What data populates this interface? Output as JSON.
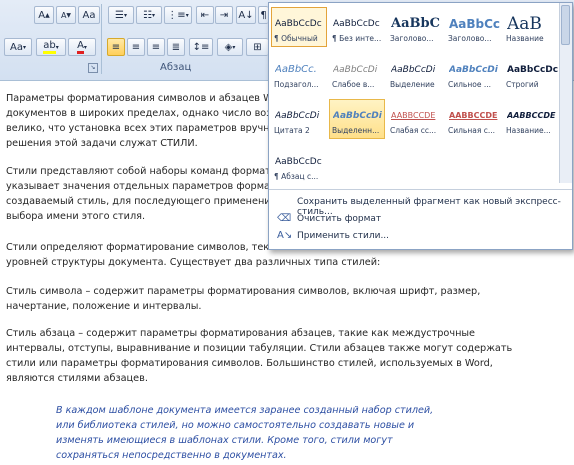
{
  "ribbon": {
    "row1": {
      "font_grow": "A",
      "font_shrink": "A",
      "clear_format": "Aa",
      "list_bullets": "☰",
      "list_numbers": "☷",
      "list_multi": "⋮≡",
      "indent_dec": "⇤",
      "indent_inc": "⇥",
      "sort": "A↓",
      "pilcrow": "¶"
    },
    "row2": {
      "change_case": "Aa",
      "highlight": "ab",
      "font_color": "A"
    },
    "paragraph_group_label": "Абзац"
  },
  "gallery": {
    "tiles": [
      {
        "preview": "AaBbCcDc",
        "caption": "¶ Обычный"
      },
      {
        "preview": "AaBbCcDc",
        "caption": "¶ Без инте..."
      },
      {
        "preview": "AaBbC",
        "caption": "Заголово..."
      },
      {
        "preview": "AaBbCc",
        "caption": "Заголово..."
      },
      {
        "preview": "AaB",
        "caption": "Название"
      },
      {
        "preview": "AaBbCc.",
        "caption": "Подзагол..."
      },
      {
        "preview": "AaBbCcDi",
        "caption": "Слабое в..."
      },
      {
        "preview": "AaBbCcDi",
        "caption": "Выделение"
      },
      {
        "preview": "AaBbCcDi",
        "caption": "Сильное ..."
      },
      {
        "preview": "AaBbCcDc",
        "caption": "Строгий"
      },
      {
        "preview": "AaBbCcDi",
        "caption": "Цитата 2"
      },
      {
        "preview": "AaBbCcDi",
        "caption": "Выделенн..."
      },
      {
        "preview": "AABBCCDE",
        "caption": "Слабая сс..."
      },
      {
        "preview": "AABBCCDE",
        "caption": "Сильная с..."
      },
      {
        "preview": "AABBCCDE",
        "caption": "Название..."
      },
      {
        "preview": "AaBbCcDc",
        "caption": "¶ Абзац с..."
      }
    ],
    "menu": {
      "save": "Сохранить выделенный фрагмент как новый экспресс-стиль...",
      "clear": "Очистить формат",
      "apply": "Применить стили..."
    }
  },
  "document": {
    "p1_l1": "Параметры форматирования символов и абзацев W",
    "p1_l2": "документов в широких пределах, однако число возм",
    "p1_l3": "велико, что установка всех этих параметров вручну",
    "p1_l4": "решения этой задачи служат СТИЛИ.",
    "p2_l1": "Стили представляют собой наборы команд формати",
    "p2_l2": "указывает значения отдельных параметров формата",
    "p2_l3": "создаваемый стиль, для последующего применения",
    "p2_l4": "выбора имени этого стиля.",
    "p3_l1": "Стили определяют форматирование символов, текст",
    "p3_l2": "уровней структуры документа. Существует два различных типа стилей:",
    "p4_l1": "Стиль символа – содержит параметры форматирования символов, включая шрифт, размер,",
    "p4_l2": "начертание, положение и интервалы.",
    "p5_l1": "Стиль абзаца – содержит параметры форматирования абзацев, такие как междустрочные",
    "p5_l2": "интервалы, отступы, выравнивание и позиции табуляции. Стили абзацев также могут содержать",
    "p5_l3": "стили или параметры форматирования символов. Большинство стилей, используемых в Word,",
    "p5_l4": "являются стилями абзацев.",
    "q_l1": "В каждом шаблоне документа имеется заранее созданный набор стилей,",
    "q_l2": "или библиотека стилей, но можно самостоятельно создавать новые и",
    "q_l3": "изменять имеющиеся в шаблонах стили. Кроме того, стили могут",
    "q_l4": "сохраняться непосредственно в документах."
  },
  "colors": {
    "ribbon_bg": "#d9e4f2",
    "accent_orange": "#e3a33a",
    "heading_blue": "#17365d",
    "quote_blue": "#2d4fa3"
  }
}
